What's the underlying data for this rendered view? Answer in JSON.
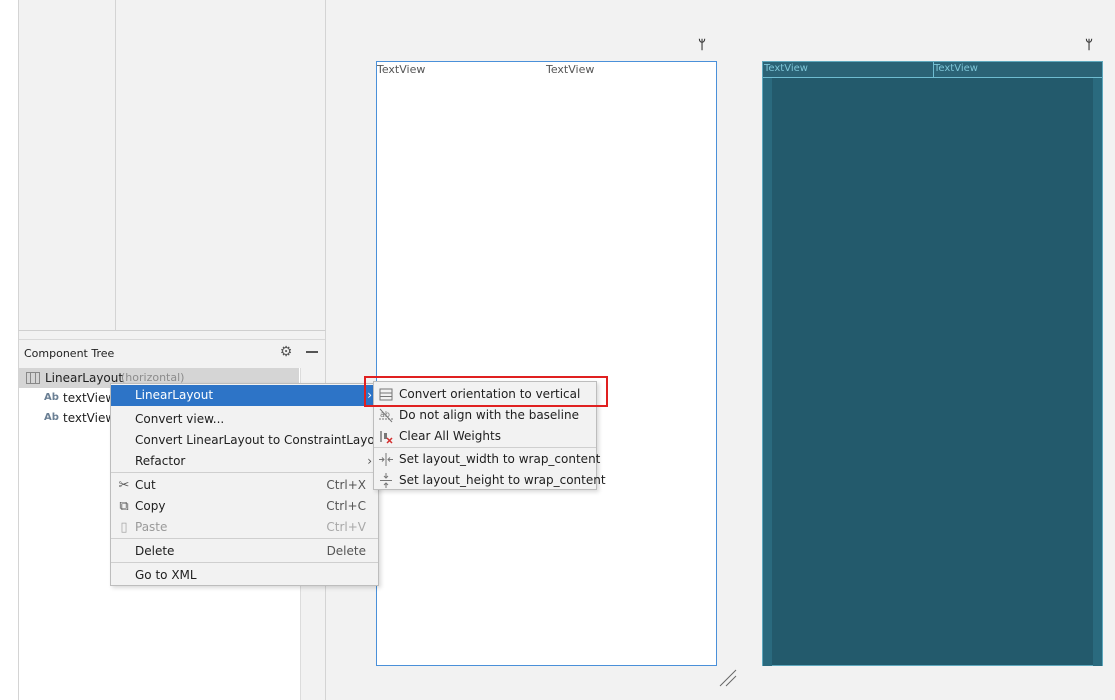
{
  "component_tree": {
    "title": "Component Tree",
    "root": {
      "label": "LinearLayout",
      "suffix": "(horizontal)"
    },
    "children": [
      {
        "icon": "Ab",
        "label": "textView7"
      },
      {
        "icon": "Ab",
        "label": "textView8"
      }
    ]
  },
  "design_preview": {
    "text_views": [
      "TextView",
      "TextView"
    ]
  },
  "blueprint_preview": {
    "text_views": [
      "TextView",
      "TextView"
    ]
  },
  "context_menu": {
    "items": [
      {
        "label": "LinearLayout",
        "has_submenu": true,
        "highlighted": true
      },
      {
        "label": "Convert view..."
      },
      {
        "label": "Convert LinearLayout to ConstraintLayout"
      },
      {
        "label": "Refactor",
        "has_submenu": true
      },
      {
        "label": "Cut",
        "shortcut": "Ctrl+X",
        "icon": "scissors-icon"
      },
      {
        "label": "Copy",
        "shortcut": "Ctrl+C",
        "icon": "copy-icon"
      },
      {
        "label": "Paste",
        "shortcut": "Ctrl+V",
        "icon": "paste-icon",
        "disabled": true
      },
      {
        "label": "Delete",
        "shortcut": "Delete"
      },
      {
        "label": "Go to XML"
      }
    ]
  },
  "submenu": {
    "items": [
      {
        "label": "Convert orientation to vertical",
        "icon": "vertical-layout-icon"
      },
      {
        "label": "Do not align with the baseline",
        "icon": "baseline-off-icon"
      },
      {
        "label": "Clear All Weights",
        "icon": "clear-weights-icon"
      },
      {
        "label": "Set layout_width to wrap_content",
        "icon": "width-wrap-icon"
      },
      {
        "label": "Set layout_height to wrap_content",
        "icon": "height-wrap-icon"
      }
    ]
  },
  "arrow_glyph": "›",
  "colors": {
    "highlight": "#2d74c7",
    "annotation": "#e02020",
    "blueprint": "#235a6c"
  }
}
